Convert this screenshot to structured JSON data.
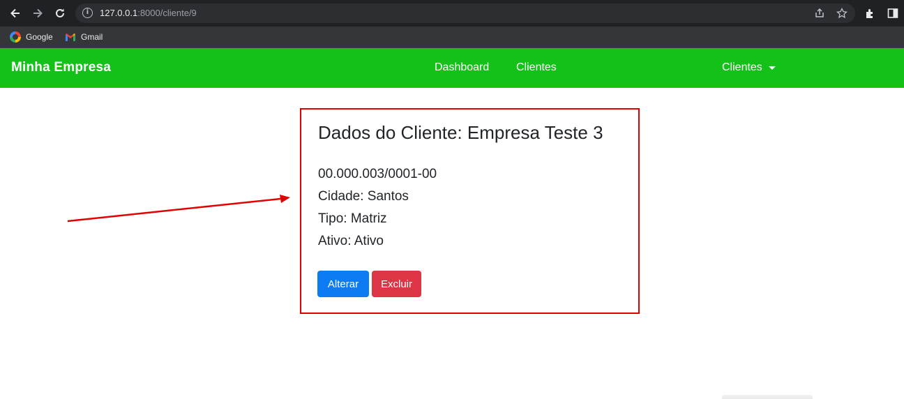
{
  "browser": {
    "url_host": "127.0.0.1",
    "url_path": ":8000/cliente/9",
    "bookmarks": [
      {
        "label": "Google",
        "icon": "google-icon"
      },
      {
        "label": "Gmail",
        "icon": "gmail-icon"
      }
    ]
  },
  "navbar": {
    "brand": "Minha Empresa",
    "links": [
      "Dashboard",
      "Clientes"
    ],
    "dropdown_label": "Clientes",
    "color": "#13c118"
  },
  "card": {
    "title": "Dados do Cliente: Empresa Teste 3",
    "cnpj": "00.000.003/0001-00",
    "cidade": "Cidade: Santos",
    "tipo": "Tipo: Matriz",
    "ativo": "Ativo: Ativo",
    "alterar_label": "Alterar",
    "excluir_label": "Excluir",
    "highlight_color": "#e00000"
  }
}
